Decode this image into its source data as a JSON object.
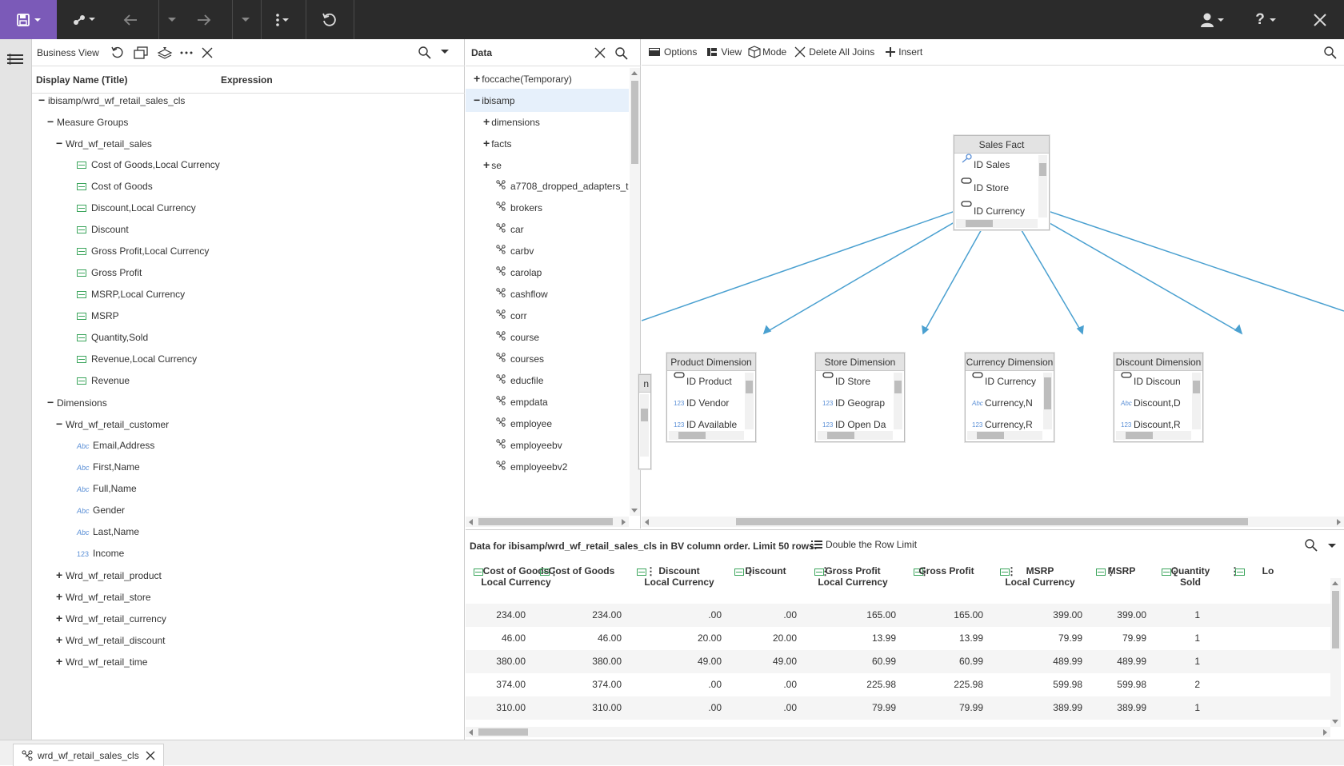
{
  "topbar": {
    "save_icon": "save-icon",
    "close_label": "✕",
    "help_label": "?"
  },
  "bv_toolbar": {
    "title": "Business View"
  },
  "bv_columns": {
    "display_name": "Display Name (Title)",
    "expression": "Expression"
  },
  "tree": {
    "root": "ibisamp/wrd_wf_retail_sales_cls",
    "measure_groups": "Measure Groups",
    "sales_group": "Wrd_wf_retail_sales",
    "measures": [
      "Cost of Goods,Local Currency",
      "Cost of Goods",
      "Discount,Local Currency",
      "Discount",
      "Gross Profit,Local Currency",
      "Gross Profit",
      "MSRP,Local Currency",
      "MSRP",
      "Quantity,Sold",
      "Revenue,Local Currency",
      "Revenue"
    ],
    "dimensions": "Dimensions",
    "customer_group": "Wrd_wf_retail_customer",
    "customer_fields": [
      {
        "label": "Email,Address",
        "icon": "Abc"
      },
      {
        "label": "First,Name",
        "icon": "Abc"
      },
      {
        "label": "Full,Name",
        "icon": "Abc"
      },
      {
        "label": "Gender",
        "icon": "Abc"
      },
      {
        "label": "Last,Name",
        "icon": "Abc"
      },
      {
        "label": "Income",
        "icon": "123"
      }
    ],
    "other_groups": [
      "Wrd_wf_retail_product",
      "Wrd_wf_retail_store",
      "Wrd_wf_retail_currency",
      "Wrd_wf_retail_discount",
      "Wrd_wf_retail_time"
    ]
  },
  "data_panel": {
    "title": "Data",
    "items": [
      {
        "label": "foccache(Temporary)",
        "kind": "folder",
        "expander": "+"
      },
      {
        "label": "ibisamp",
        "kind": "folder",
        "expander": "−"
      },
      {
        "label": "dimensions",
        "kind": "folder",
        "expander": "+"
      },
      {
        "label": "facts",
        "kind": "folder",
        "expander": "+"
      },
      {
        "label": "se",
        "kind": "folder",
        "expander": "+"
      },
      {
        "label": "a7708_dropped_adapters_t",
        "kind": "node"
      },
      {
        "label": "brokers",
        "kind": "node"
      },
      {
        "label": "car",
        "kind": "node"
      },
      {
        "label": "carbv",
        "kind": "node"
      },
      {
        "label": "carolap",
        "kind": "node"
      },
      {
        "label": "cashflow",
        "kind": "node"
      },
      {
        "label": "corr",
        "kind": "node"
      },
      {
        "label": "course",
        "kind": "node"
      },
      {
        "label": "courses",
        "kind": "node"
      },
      {
        "label": "educfile",
        "kind": "node"
      },
      {
        "label": "empdata",
        "kind": "node"
      },
      {
        "label": "employee",
        "kind": "node"
      },
      {
        "label": "employeebv",
        "kind": "node"
      },
      {
        "label": "employeebv2",
        "kind": "node"
      }
    ]
  },
  "diagram_toolbar": {
    "options": "Options",
    "view": "View",
    "mode": "Mode",
    "delete_joins": "Delete All Joins",
    "insert": "Insert"
  },
  "diagram": {
    "fact": {
      "title": "Sales Fact",
      "fields": [
        "ID Sales",
        "ID Store",
        "ID Currency"
      ]
    },
    "partial": {
      "title": "n"
    },
    "dims": [
      {
        "title": "Product Dimension",
        "fields": [
          {
            "label": "ID Product",
            "icon": "key"
          },
          {
            "label": "ID Vendor",
            "icon": "123"
          },
          {
            "label": "ID Available",
            "icon": "123"
          }
        ]
      },
      {
        "title": "Store Dimension",
        "fields": [
          {
            "label": "ID Store",
            "icon": "key"
          },
          {
            "label": "ID Geograp",
            "icon": "123"
          },
          {
            "label": "ID Open Da",
            "icon": "123"
          }
        ]
      },
      {
        "title": "Currency Dimension",
        "fields": [
          {
            "label": "ID Currency",
            "icon": "key"
          },
          {
            "label": "Currency,N",
            "icon": "Abc"
          },
          {
            "label": "Currency,R",
            "icon": "123"
          }
        ]
      },
      {
        "title": "Discount Dimension",
        "fields": [
          {
            "label": "ID Discoun",
            "icon": "key"
          },
          {
            "label": "Discount,D",
            "icon": "Abc"
          },
          {
            "label": "Discount,R",
            "icon": "123"
          }
        ]
      }
    ]
  },
  "grid": {
    "caption": "Data for ibisamp/wrd_wf_retail_sales_cls in BV column order. Limit 50 rows.",
    "double_limit": "Double the Row Limit",
    "columns": [
      {
        "line1": "Cost of Goods",
        "line2": "Local Currency"
      },
      {
        "line1": "Cost of Goods",
        "line2": ""
      },
      {
        "line1": "Discount",
        "line2": "Local Currency"
      },
      {
        "line1": "Discount",
        "line2": ""
      },
      {
        "line1": "Gross Profit",
        "line2": "Local Currency"
      },
      {
        "line1": "Gross Profit",
        "line2": ""
      },
      {
        "line1": "MSRP",
        "line2": "Local Currency"
      },
      {
        "line1": "MSRP",
        "line2": ""
      },
      {
        "line1": "Quantity",
        "line2": "Sold"
      },
      {
        "line1": "",
        "line2": "Lo"
      }
    ],
    "rows": [
      [
        "234.00",
        "234.00",
        ".00",
        ".00",
        "165.00",
        "165.00",
        "399.00",
        "399.00",
        "1"
      ],
      [
        "46.00",
        "46.00",
        "20.00",
        "20.00",
        "13.99",
        "13.99",
        "79.99",
        "79.99",
        "1"
      ],
      [
        "380.00",
        "380.00",
        "49.00",
        "49.00",
        "60.99",
        "60.99",
        "489.99",
        "489.99",
        "1"
      ],
      [
        "374.00",
        "374.00",
        ".00",
        ".00",
        "225.98",
        "225.98",
        "599.98",
        "599.98",
        "2"
      ],
      [
        "310.00",
        "310.00",
        ".00",
        ".00",
        "79.99",
        "79.99",
        "389.99",
        "389.99",
        "1"
      ]
    ]
  },
  "bottom_tab": {
    "label": "wrd_wf_retail_sales_cls"
  },
  "colors": {
    "topbar": "#2b2b2b",
    "save_accent": "#7b5ab8",
    "join_line": "#4aa0d0",
    "selected_row": "#e6f0fb"
  }
}
